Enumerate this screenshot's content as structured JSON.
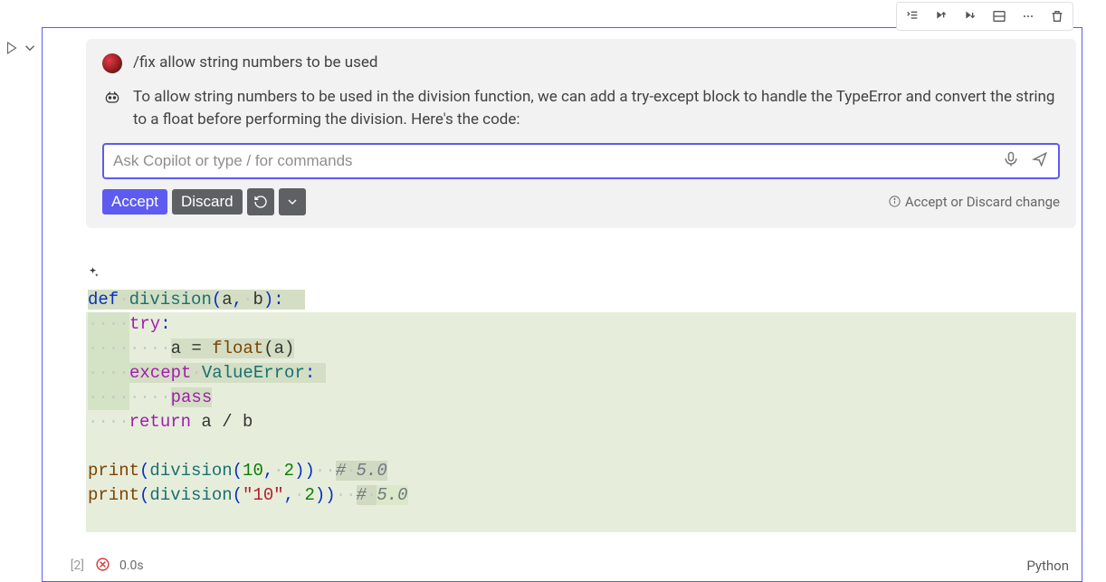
{
  "chat": {
    "user_prompt": "/fix allow string numbers to be used",
    "assistant_reply": "To allow string numbers to be used in the division function, we can add a try-except block to handle the TypeError and convert the string to a float before performing the division. Here's the code:",
    "input_placeholder": "Ask Copilot or type / for commands"
  },
  "actions": {
    "accept": "Accept",
    "discard": "Discard",
    "hint": "Accept or Discard change"
  },
  "code": {
    "l1_def": "def",
    "l1_name": "division",
    "l1_params": "(a, b):",
    "l2": "try",
    "l3_a": "a = ",
    "l3_float": "float",
    "l3_rest": "(a)",
    "l4_except": "except",
    "l4_err": "ValueError",
    "l5": "pass",
    "l6_return": "return",
    "l6_rest": " a / b",
    "p1_print": "print",
    "p1_args_a": "(division(",
    "p1_n1": "10",
    "p1_sep": ", ",
    "p1_n2": "2",
    "p1_close": "))",
    "p1_comment": "# 5.0",
    "p2_print": "print",
    "p2_args_a": "(division(",
    "p2_str": "\"10\"",
    "p2_sep": ", ",
    "p2_n2": "2",
    "p2_close": "))",
    "p2_comment": "# 5.0"
  },
  "status": {
    "exec_count": "[2]",
    "time": "0.0s",
    "lang": "Python"
  },
  "icons": {
    "run_by_line": "run-by-line-icon",
    "run_above": "run-above-icon",
    "run_below": "run-below-icon",
    "split": "split-icon",
    "more": "more-icon",
    "trash": "trash-icon"
  }
}
